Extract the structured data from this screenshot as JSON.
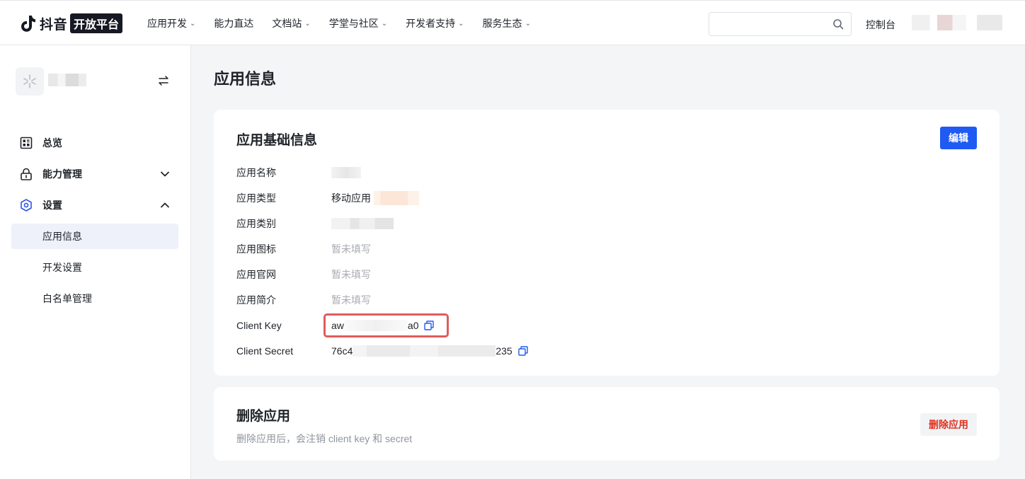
{
  "brand": {
    "name": "抖音",
    "badge": "开放平台"
  },
  "nav": {
    "items": [
      {
        "label": "应用开发",
        "dropdown": true
      },
      {
        "label": "能力直达",
        "dropdown": false
      },
      {
        "label": "文档站",
        "dropdown": true
      },
      {
        "label": "学堂与社区",
        "dropdown": true
      },
      {
        "label": "开发者支持",
        "dropdown": true
      },
      {
        "label": "服务生态",
        "dropdown": true
      }
    ],
    "caret": "⌄",
    "search_placeholder": "",
    "console_label": "控制台"
  },
  "sidebar": {
    "menu": {
      "overview": "总览",
      "capability": "能力管理",
      "settings": "设置",
      "app_info": "应用信息",
      "dev_settings": "开发设置",
      "whitelist": "白名单管理"
    }
  },
  "page": {
    "title": "应用信息"
  },
  "basic_info": {
    "title": "应用基础信息",
    "edit_label": "编辑",
    "fields": {
      "name_label": "应用名称",
      "type_label": "应用类型",
      "type_value": "移动应用",
      "category_label": "应用类别",
      "icon_label": "应用图标",
      "icon_value": "暂未填写",
      "website_label": "应用官网",
      "website_value": "暂未填写",
      "intro_label": "应用简介",
      "intro_value": "暂未填写",
      "client_key_label": "Client Key",
      "client_key_prefix": "aw",
      "client_key_suffix": "a0",
      "client_secret_label": "Client Secret",
      "client_secret_prefix": "76c4",
      "client_secret_suffix": "235"
    }
  },
  "delete_app": {
    "title": "删除应用",
    "description": "删除应用后，会注销 client key 和 secret",
    "button_label": "删除应用"
  },
  "colors": {
    "primary": "#1f5bf2",
    "danger": "#e0311f",
    "highlight_box": "#e05c5c"
  }
}
